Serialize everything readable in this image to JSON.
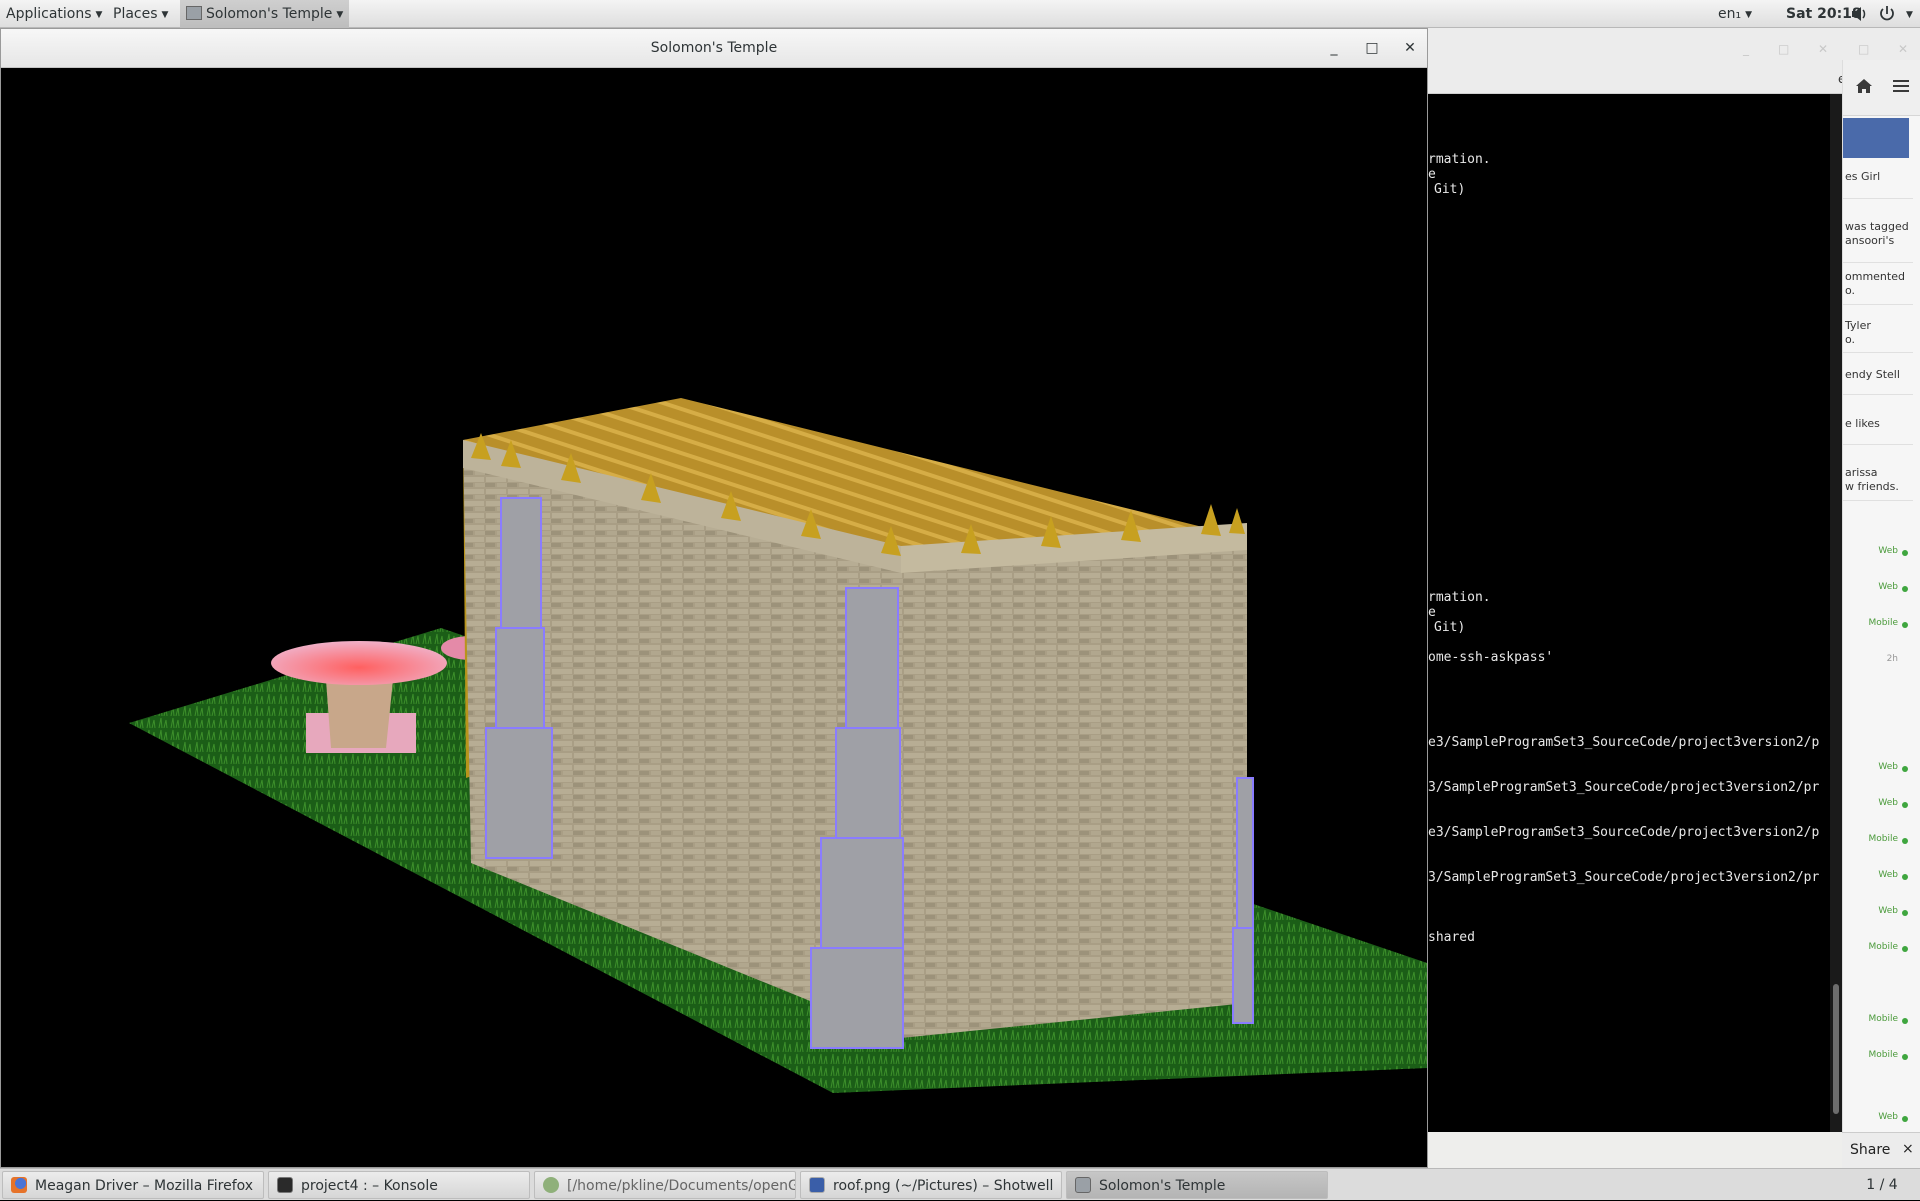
{
  "top_panel": {
    "applications": "Applications",
    "places": "Places",
    "app_name": "Solomon's Temple",
    "keyboard": "en₁",
    "clock": "Sat 20:18"
  },
  "main_window": {
    "title": "Solomon's Temple",
    "controls": {
      "minimize": "_",
      "maximize": "□",
      "close": "✕"
    }
  },
  "terminal": {
    "lines": [
      "rmation.",
      "e",
      "Git)",
      "rmation.",
      "e",
      "Git)",
      "ome-ssh-askpass'",
      "e3/SampleProgramSet3_SourceCode/project3version2/p",
      "3/SampleProgramSet3_SourceCode/project3version2/pr",
      "e3/SampleProgramSet3_SourceCode/project3version2/p",
      "3/SampleProgramSet3_SourceCode/project3version2/pr",
      "shared"
    ]
  },
  "firefox_panel": {
    "items": [
      "es Girl",
      "was tagged",
      "ansoori's",
      "ommented",
      "o.",
      "Tyler",
      "o.",
      "endy Stell",
      "e likes",
      "arissa",
      "w friends."
    ],
    "statuses": [
      "Web",
      "Web",
      "Mobile",
      "2h",
      "Web",
      "Web",
      "Mobile",
      "Web",
      "Web",
      "Mobile",
      "Mobile",
      "Mobile",
      "Web"
    ],
    "share": "Share",
    "tab_fragment": "e...",
    "close": "×"
  },
  "taskbar": {
    "tasks": [
      {
        "label": "Meagan Driver – Mozilla Firefox",
        "icon": "firefox-icon"
      },
      {
        "label": "project4 : – Konsole",
        "icon": "terminal-icon"
      },
      {
        "label": "[/home/pkline/Documents/openGL...",
        "icon": "gear-icon"
      },
      {
        "label": "roof.png (~/Pictures) – Shotwell",
        "icon": "image-icon"
      },
      {
        "label": "Solomon's Temple",
        "icon": "window-icon"
      }
    ],
    "workspace": "1 / 4"
  },
  "colors": {
    "grass": "#1f6a1a",
    "stone": "#a89f86",
    "roof": "#b8902a",
    "pillar": "#a4a4a8",
    "basin": "#e8888f"
  }
}
